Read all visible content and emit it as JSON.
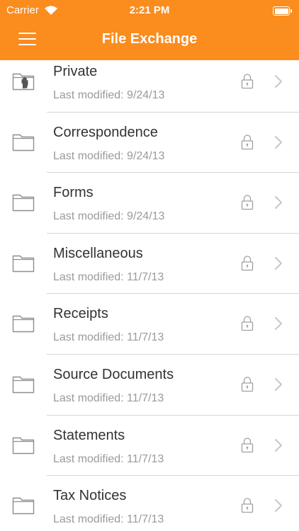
{
  "status_bar": {
    "carrier": "Carrier",
    "time": "2:21 PM"
  },
  "nav": {
    "title": "File Exchange"
  },
  "colors": {
    "header": "#fb8c1e",
    "title_text": "#333333",
    "subtitle_text": "#9a9a9a",
    "icon_gray": "#9a9a9a"
  },
  "folders": [
    {
      "name": "Private",
      "modified": "Last modified: 9/24/13",
      "icon": "private-folder-icon"
    },
    {
      "name": "Correspondence",
      "modified": "Last modified: 9/24/13",
      "icon": "folder-icon"
    },
    {
      "name": "Forms",
      "modified": "Last modified: 9/24/13",
      "icon": "folder-icon"
    },
    {
      "name": "Miscellaneous",
      "modified": "Last modified: 11/7/13",
      "icon": "folder-icon"
    },
    {
      "name": "Receipts",
      "modified": "Last modified: 11/7/13",
      "icon": "folder-icon"
    },
    {
      "name": "Source Documents",
      "modified": "Last modified: 11/7/13",
      "icon": "folder-icon"
    },
    {
      "name": "Statements",
      "modified": "Last modified: 11/7/13",
      "icon": "folder-icon"
    },
    {
      "name": "Tax Notices",
      "modified": "Last modified: 11/7/13",
      "icon": "folder-icon"
    }
  ]
}
